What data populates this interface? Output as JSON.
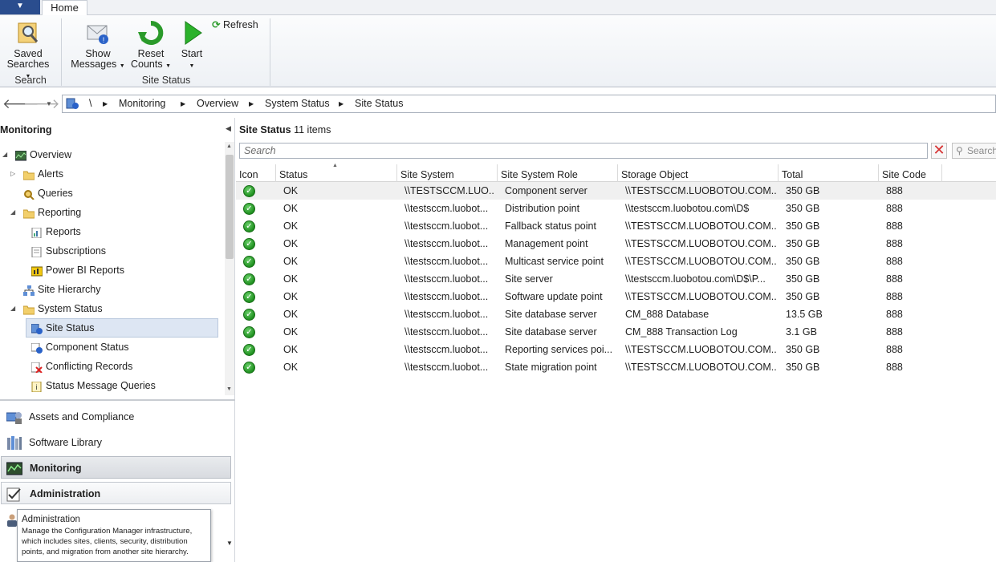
{
  "ribbon": {
    "tab_home": "Home",
    "buttons": {
      "saved_searches": {
        "line1": "Saved",
        "line2": "Searches"
      },
      "show_messages": {
        "line1": "Show",
        "line2": "Messages"
      },
      "reset_counts": {
        "line1": "Reset",
        "line2": "Counts"
      },
      "start": {
        "line1": "Start"
      },
      "refresh": {
        "label": "Refresh"
      }
    },
    "groups": {
      "search": "Search",
      "site_status": "Site Status"
    }
  },
  "breadcrumb": {
    "root": "\\",
    "items": [
      "Monitoring",
      "Overview",
      "System Status",
      "Site Status"
    ]
  },
  "leftpane": {
    "title": "Monitoring",
    "tree": [
      {
        "label": "Overview",
        "icon": "overview-icon"
      },
      {
        "label": "Alerts",
        "icon": "folder-icon"
      },
      {
        "label": "Queries",
        "icon": "queries-icon"
      },
      {
        "label": "Reporting",
        "icon": "folder-icon"
      },
      {
        "label": "Reports",
        "icon": "report-icon"
      },
      {
        "label": "Subscriptions",
        "icon": "subscription-icon"
      },
      {
        "label": "Power BI Reports",
        "icon": "powerbi-icon"
      },
      {
        "label": "Site Hierarchy",
        "icon": "hierarchy-icon"
      },
      {
        "label": "System Status",
        "icon": "folder-icon"
      },
      {
        "label": "Site Status",
        "icon": "site-status-icon"
      },
      {
        "label": "Component Status",
        "icon": "component-status-icon"
      },
      {
        "label": "Conflicting Records",
        "icon": "conflict-icon"
      },
      {
        "label": "Status Message Queries",
        "icon": "status-message-icon"
      }
    ],
    "workspaces": [
      "Assets and Compliance",
      "Software Library",
      "Monitoring",
      "Administration"
    ],
    "tooltip": {
      "title": "Administration",
      "text": "Manage the Configuration Manager infrastructure, which includes sites, clients, security, distribution points, and migration from another site hierarchy."
    }
  },
  "main": {
    "title": "Site Status",
    "count": "11 items",
    "search_placeholder": "Search",
    "search_button": "Search",
    "columns": [
      "Icon",
      "Status",
      "Site System",
      "Site System Role",
      "Storage Object",
      "Total",
      "Site Code"
    ],
    "rows": [
      {
        "status": "OK",
        "site_system": "\\\\TESTSCCM.LUO...",
        "role": "Component server",
        "storage": "\\\\TESTSCCM.LUOBOTOU.COM...",
        "total": "350 GB",
        "code": "888"
      },
      {
        "status": "OK",
        "site_system": "\\\\testsccm.luobot...",
        "role": "Distribution point",
        "storage": "\\\\testsccm.luobotou.com\\D$",
        "total": "350 GB",
        "code": "888"
      },
      {
        "status": "OK",
        "site_system": "\\\\testsccm.luobot...",
        "role": "Fallback status point",
        "storage": "\\\\TESTSCCM.LUOBOTOU.COM...",
        "total": "350 GB",
        "code": "888"
      },
      {
        "status": "OK",
        "site_system": "\\\\testsccm.luobot...",
        "role": "Management point",
        "storage": "\\\\TESTSCCM.LUOBOTOU.COM...",
        "total": "350 GB",
        "code": "888"
      },
      {
        "status": "OK",
        "site_system": "\\\\testsccm.luobot...",
        "role": "Multicast service point",
        "storage": "\\\\TESTSCCM.LUOBOTOU.COM...",
        "total": "350 GB",
        "code": "888"
      },
      {
        "status": "OK",
        "site_system": "\\\\testsccm.luobot...",
        "role": "Site server",
        "storage": "\\\\testsccm.luobotou.com\\D$\\P...",
        "total": "350 GB",
        "code": "888"
      },
      {
        "status": "OK",
        "site_system": "\\\\testsccm.luobot...",
        "role": "Software update point",
        "storage": "\\\\TESTSCCM.LUOBOTOU.COM...",
        "total": "350 GB",
        "code": "888"
      },
      {
        "status": "OK",
        "site_system": "\\\\testsccm.luobot...",
        "role": "Site database server",
        "storage": "CM_888 Database",
        "total": "13.5 GB",
        "code": "888"
      },
      {
        "status": "OK",
        "site_system": "\\\\testsccm.luobot...",
        "role": "Site database server",
        "storage": "CM_888 Transaction Log",
        "total": "3.1 GB",
        "code": "888"
      },
      {
        "status": "OK",
        "site_system": "\\\\testsccm.luobot...",
        "role": "Reporting services poi...",
        "storage": "\\\\TESTSCCM.LUOBOTOU.COM...",
        "total": "350 GB",
        "code": "888"
      },
      {
        "status": "OK",
        "site_system": "\\\\testsccm.luobot...",
        "role": "State migration point",
        "storage": "\\\\TESTSCCM.LUOBOTOU.COM...",
        "total": "350 GB",
        "code": "888"
      }
    ]
  },
  "colors": {
    "accent": "#2a4d8e",
    "ok_green": "#1f8f1f",
    "selection": "#dde6f3"
  }
}
